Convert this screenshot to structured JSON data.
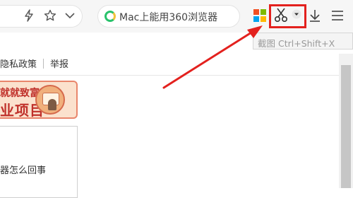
{
  "toolbar": {
    "search_text": "Mac上能用360浏览器",
    "icons": [
      "lightning-icon",
      "star-icon",
      "chevron-down-icon",
      "search-icon",
      "app-grid-icon",
      "scissors-icon",
      "dropdown-icon",
      "download-icon",
      "menu-icon"
    ],
    "tooltip": "截图 Ctrl+Shift+X"
  },
  "page": {
    "links": [
      "隐私政策",
      "举报"
    ],
    "banner": {
      "line1": "就就致富梦",
      "line2": "业项目"
    },
    "card_text": "器怎么回事"
  },
  "colors": {
    "annotation_red": "#e3211e",
    "toolbar_bg": "#f6f6f6"
  }
}
